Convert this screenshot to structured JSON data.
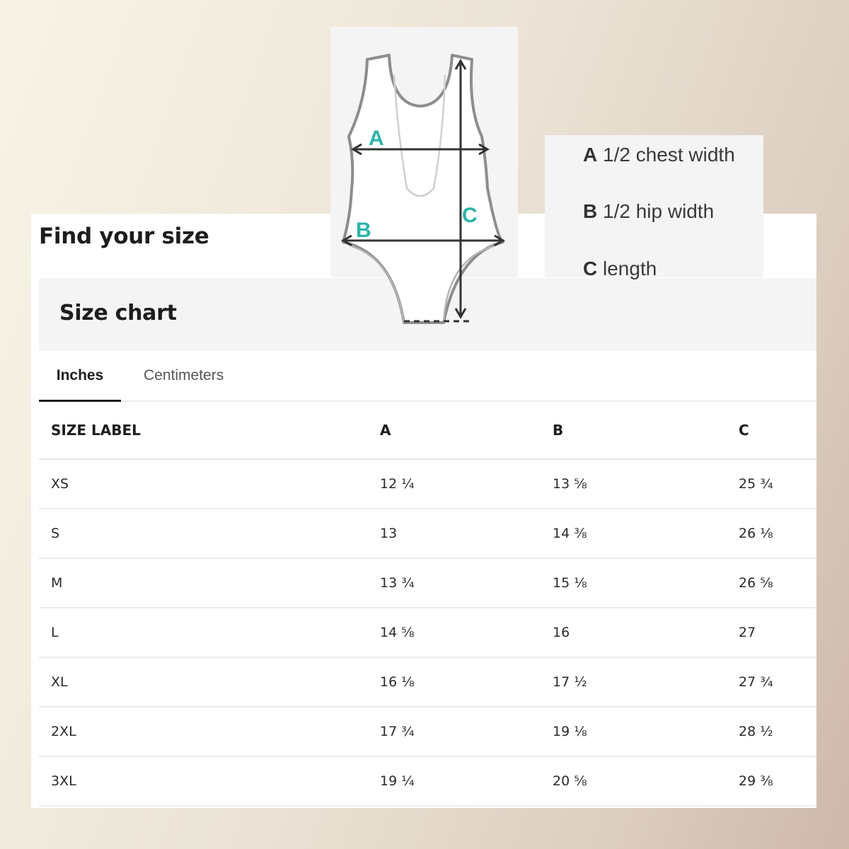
{
  "header": {
    "title": "Find your size"
  },
  "size_chart": {
    "title": "Size chart",
    "tabs": [
      {
        "label": "Inches",
        "active": true
      },
      {
        "label": "Centimeters",
        "active": false
      }
    ],
    "columns": [
      "SIZE LABEL",
      "A",
      "B",
      "C"
    ],
    "rows": [
      [
        "XS",
        "12 ¼",
        "13 ⅝",
        "25 ¾"
      ],
      [
        "S",
        "13",
        "14 ⅜",
        "26 ⅛"
      ],
      [
        "M",
        "13 ¾",
        "15 ⅛",
        "26 ⅝"
      ],
      [
        "L",
        "14 ⅝",
        "16",
        "27"
      ],
      [
        "XL",
        "16 ⅛",
        "17 ½",
        "27 ¾"
      ],
      [
        "2XL",
        "17 ¾",
        "19 ⅛",
        "28 ½"
      ],
      [
        "3XL",
        "19 ¼",
        "20 ⅝",
        "29 ⅜"
      ]
    ]
  },
  "diagram": {
    "labels": {
      "a": "A",
      "b": "B",
      "c": "C"
    },
    "accent_color": "#2bb3a8",
    "outline_color": "#8d8d8d"
  },
  "legend": {
    "items": [
      {
        "letter": "A",
        "text": "1/2 chest width"
      },
      {
        "letter": "B",
        "text": "1/2 hip width"
      },
      {
        "letter": "C",
        "text": "length"
      }
    ]
  }
}
